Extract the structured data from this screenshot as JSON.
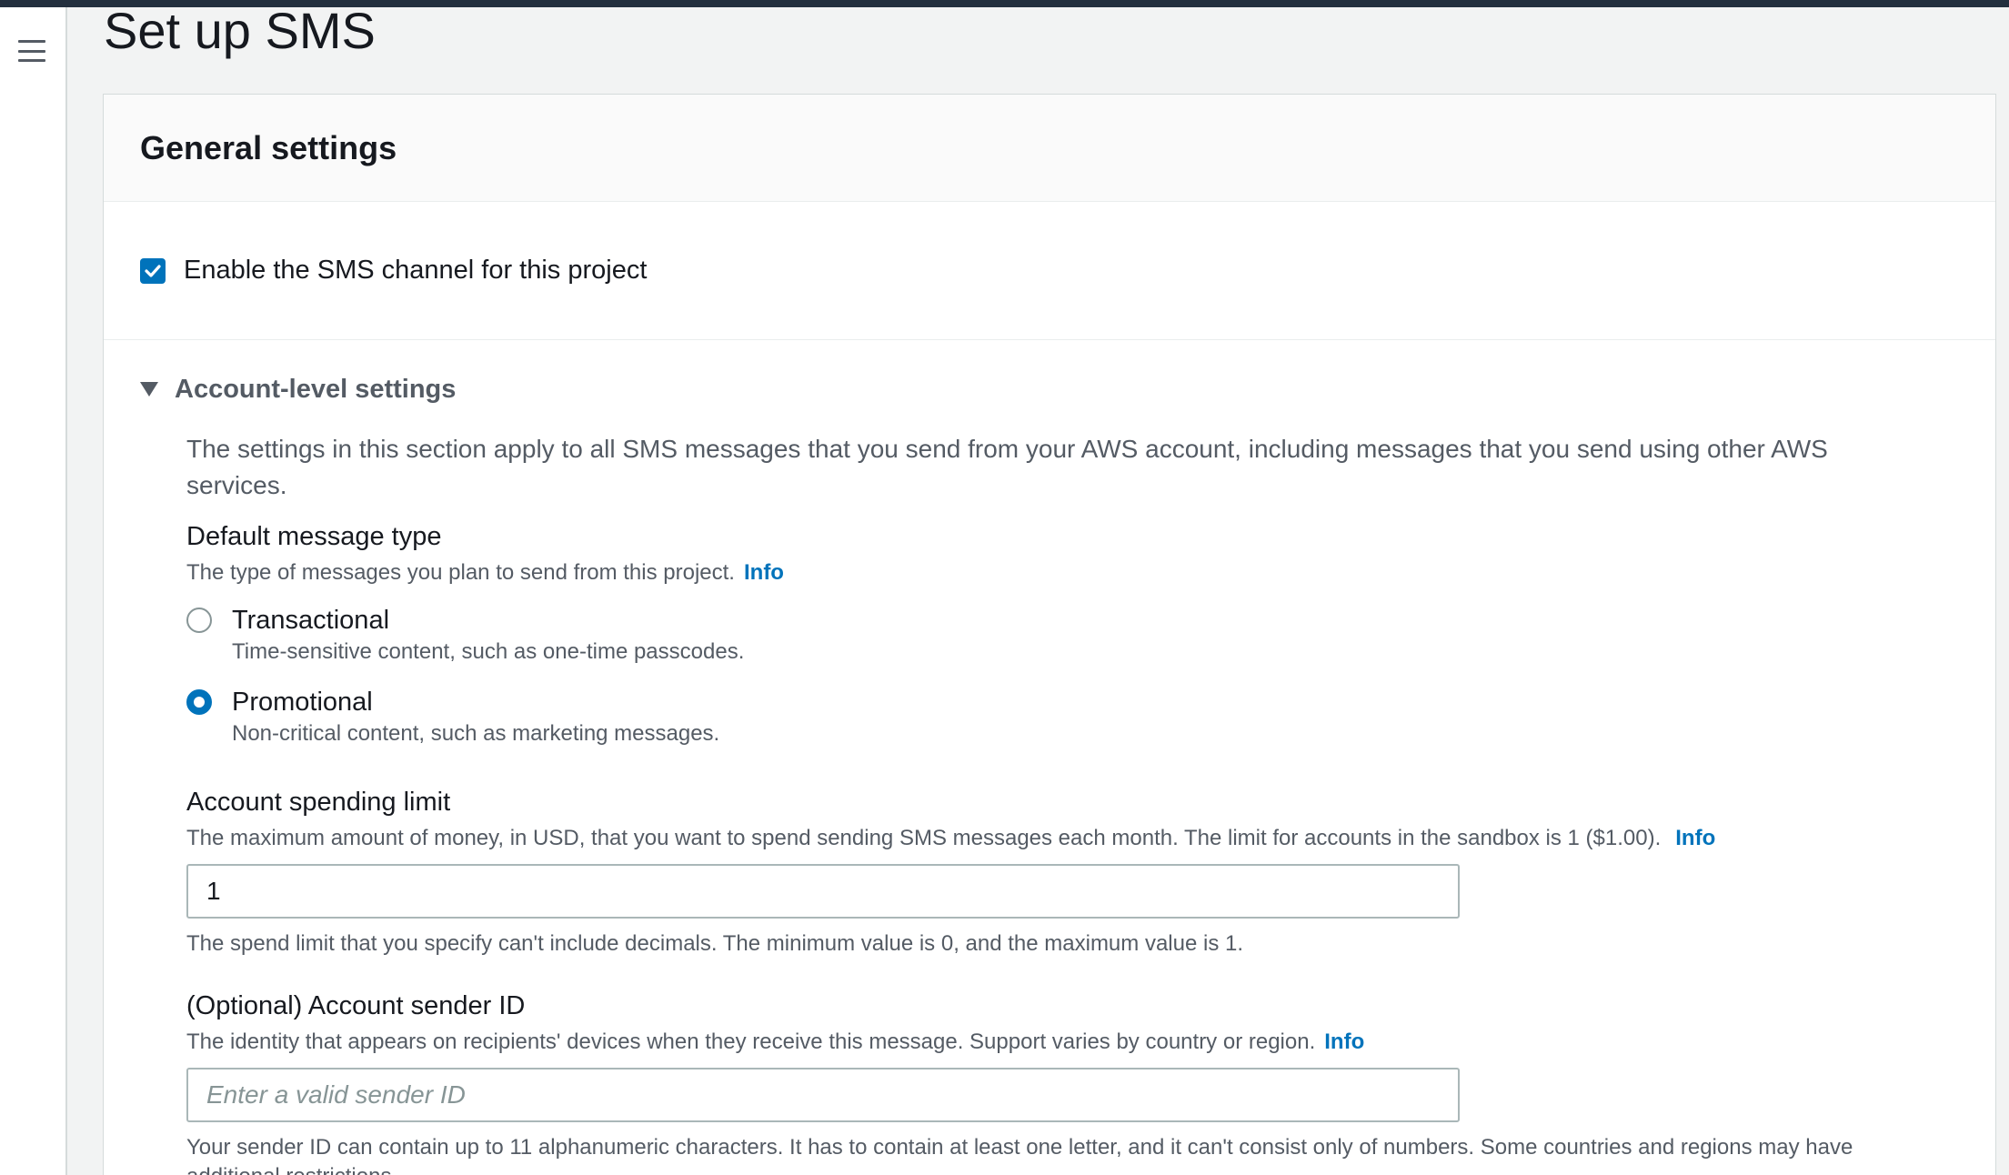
{
  "page": {
    "title": "Set up SMS"
  },
  "general_settings": {
    "heading": "General settings",
    "enable_sms": {
      "label": "Enable the SMS channel for this project",
      "checked": true
    }
  },
  "account_level": {
    "toggle_label": "Account-level settings",
    "description": "The settings in this section apply to all SMS messages that you send from your AWS account, including messages that you send using other AWS services.",
    "message_type": {
      "label": "Default message type",
      "description": "The type of messages you plan to send from this project.",
      "info": "Info",
      "options": [
        {
          "title": "Transactional",
          "description": "Time-sensitive content, such as one-time passcodes.",
          "selected": false
        },
        {
          "title": "Promotional",
          "description": "Non-critical content, such as marketing messages.",
          "selected": true
        }
      ]
    },
    "spending_limit": {
      "label": "Account spending limit",
      "description": "The maximum amount of money, in USD, that you want to spend sending SMS messages each month. The limit for accounts in the sandbox is 1 ($1.00).",
      "info": "Info",
      "value": "1",
      "constraint": "The spend limit that you specify can't include decimals. The minimum value is 0, and the maximum value is 1."
    },
    "sender_id": {
      "label": "(Optional) Account sender ID",
      "description": "The identity that appears on recipients' devices when they receive this message. Support varies by country or region.",
      "info": "Info",
      "placeholder": "Enter a valid sender ID",
      "constraint": "Your sender ID can contain up to 11 alphanumeric characters. It has to contain at least one letter, and it can't consist only of numbers. Some countries and regions may have additional restrictions."
    }
  },
  "colors": {
    "accent": "#0073bb",
    "text": "#16191f",
    "secondary_text": "#545b64",
    "background": "#f2f3f3"
  },
  "icons": {
    "menu": "hamburger-menu-icon",
    "checkbox": "checkmark-icon",
    "expand": "caret-down-icon"
  }
}
